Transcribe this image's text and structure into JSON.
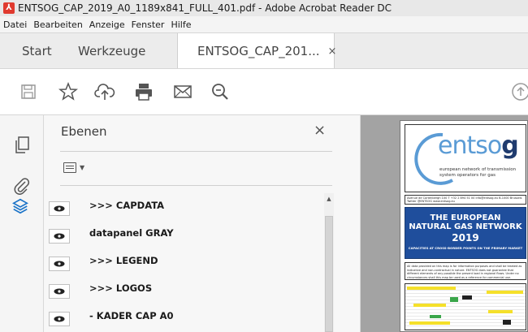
{
  "window": {
    "title": "ENTSOG_CAP_2019_A0_1189x841_FULL_401.pdf - Adobe Acrobat Reader DC",
    "app_icon": "acrobat-icon"
  },
  "menu": [
    "Datei",
    "Bearbeiten",
    "Anzeige",
    "Fenster",
    "Hilfe"
  ],
  "tabs": {
    "start": "Start",
    "tools": "Werkzeuge",
    "document": "ENTSOG_CAP_201...",
    "close": "×"
  },
  "toolbar": {
    "icons": [
      "save-icon",
      "bookmark-star-icon",
      "upload-cloud-icon",
      "print-icon",
      "email-icon",
      "zoom-icon",
      "help-icon"
    ]
  },
  "left_rail": {
    "icons": [
      "pages-icon",
      "attachments-icon",
      "layers-icon"
    ]
  },
  "layers_panel": {
    "title": "Ebenen",
    "close": "×",
    "layers": [
      {
        "label": ">>> CAPDATA"
      },
      {
        "label": "datapanel GRAY"
      },
      {
        "label": ">>> LEGEND"
      },
      {
        "label": ">>> LOGOS"
      },
      {
        "label": "- KADER CAP A0"
      }
    ]
  },
  "document": {
    "logo": {
      "text_light": "entso",
      "text_bold": "g"
    },
    "logo_sub": "european network of transmission system operators for gas",
    "contact": "Avenue de Cortenbergh 100   T +32 2 894 51 00   info@entsog.eu   B-1000 Brussels   Twitter @ENTSOG   www.entsog.eu",
    "heading1": "THE EUROPEAN",
    "heading2": "NATURAL GAS NETWORK",
    "heading3": "2019",
    "heading4": "CAPACITIES AT CROSS-BORDER POINTS ON THE PRIMARY MARKET",
    "disclaimer": "All data provided on this map is for information purposes and shall be treated as indicative and non-contractual in nature. ENTSOG does not guarantee that different elements of any possible the present load in regional flows. Under no circumstances shall this map be used as a reference for commercial use."
  },
  "colors": {
    "heading_bg": "#1f4e9c",
    "logo_light": "#5a9bd5",
    "logo_dark": "#1f3b6e",
    "acrobat_red": "#e03a2f"
  }
}
